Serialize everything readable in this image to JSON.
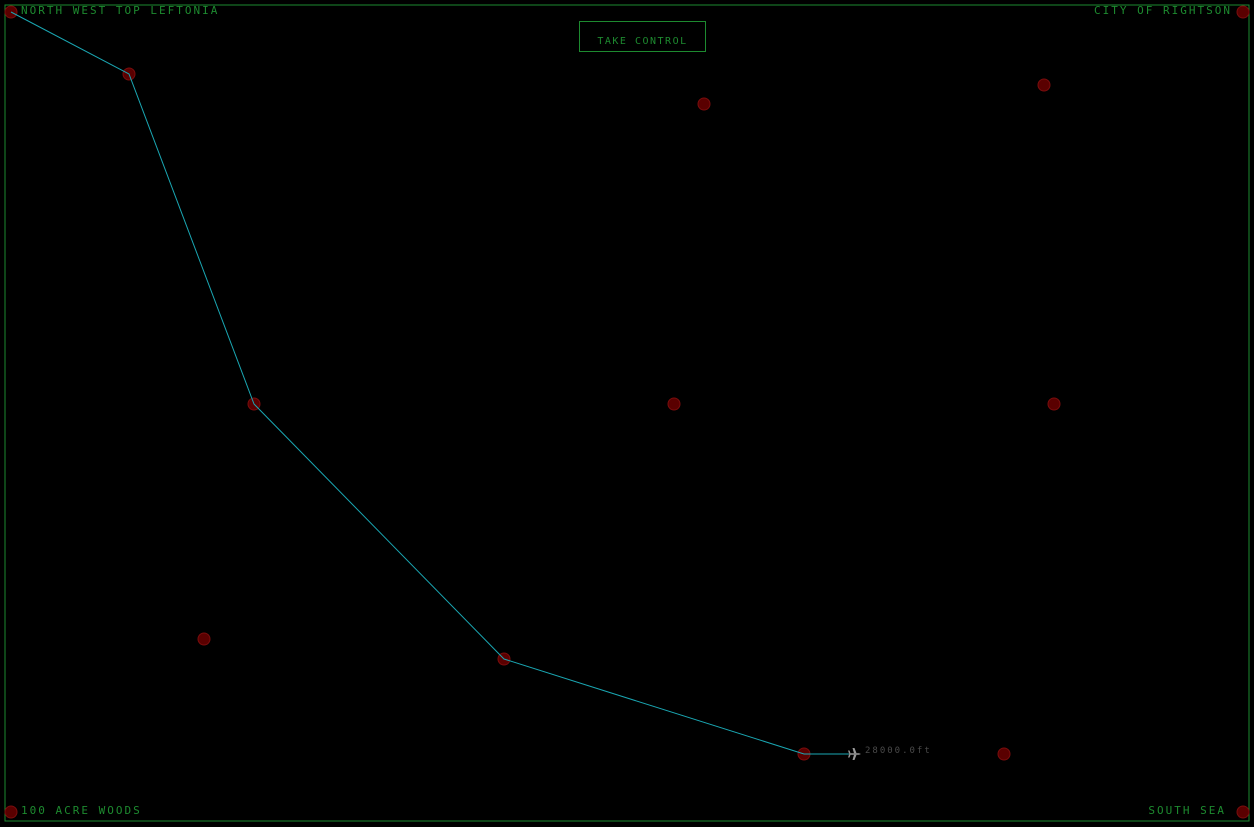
{
  "map": {
    "labels": {
      "north_west": "NORTH WEST TOP LEFTONIA",
      "north_east": "CITY OF RIGHTSON",
      "south_west": "100 ACRE WOODS",
      "south_east": "SOUTH SEA"
    },
    "colors": {
      "background": "#000000",
      "border": "#1d8a2f",
      "label": "#1d8a2f",
      "route": "#1aa7b3",
      "waypoint": "#5a0000",
      "aircraft": "#9a9a9a",
      "altitude_text": "#4a4a4a"
    }
  },
  "controls": {
    "take_control_label": "TAKE CONTROL"
  },
  "aircraft": {
    "icon": "airplane-icon",
    "altitude": "28000.0ft"
  }
}
